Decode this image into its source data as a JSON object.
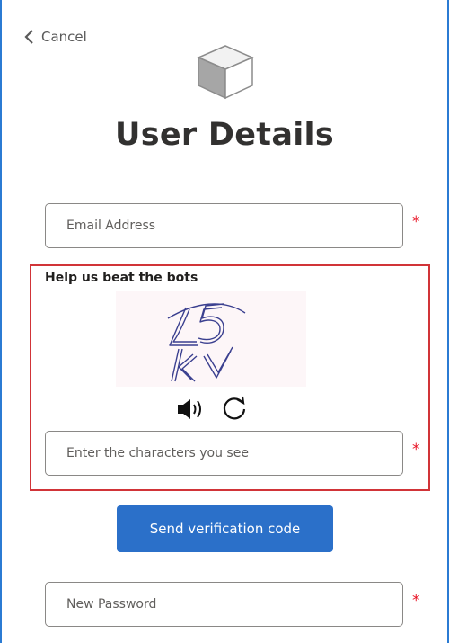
{
  "header": {
    "cancel_label": "Cancel",
    "title": "User Details"
  },
  "email": {
    "placeholder": "Email Address",
    "value": "",
    "required_mark": "*"
  },
  "captcha": {
    "heading": "Help us beat the bots",
    "image_text": "L5 kV",
    "audio_icon": "speaker-icon",
    "refresh_icon": "refresh-icon",
    "input_placeholder": "Enter the characters you see",
    "input_value": "",
    "required_mark": "*",
    "border_color": "#d13438"
  },
  "send_button": {
    "label": "Send verification code",
    "color": "#2b70c9"
  },
  "password": {
    "placeholder": "New Password",
    "value": "",
    "required_mark": "*"
  },
  "colors": {
    "accent": "#2b70c9",
    "required": "#e81123"
  }
}
